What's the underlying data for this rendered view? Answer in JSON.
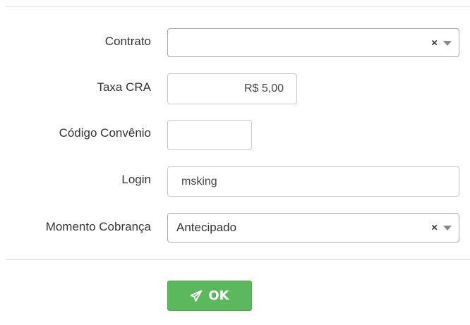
{
  "form": {
    "contrato": {
      "label": "Contrato",
      "value": ""
    },
    "taxa_cra": {
      "label": "Taxa CRA",
      "value": "R$ 5,00"
    },
    "codigo_convenio": {
      "label": "Código Convênio",
      "value": ""
    },
    "login": {
      "label": "Login",
      "value": "msking"
    },
    "momento_cobranca": {
      "label": "Momento Cobrança",
      "value": "Antecipado"
    },
    "clear_glyph": "×"
  },
  "actions": {
    "ok_label": "OK",
    "ok_icon": "paper-plane-icon"
  },
  "colors": {
    "ok_button_bg": "#5cb85c",
    "border": "#c8c8c8",
    "text": "#333333"
  }
}
